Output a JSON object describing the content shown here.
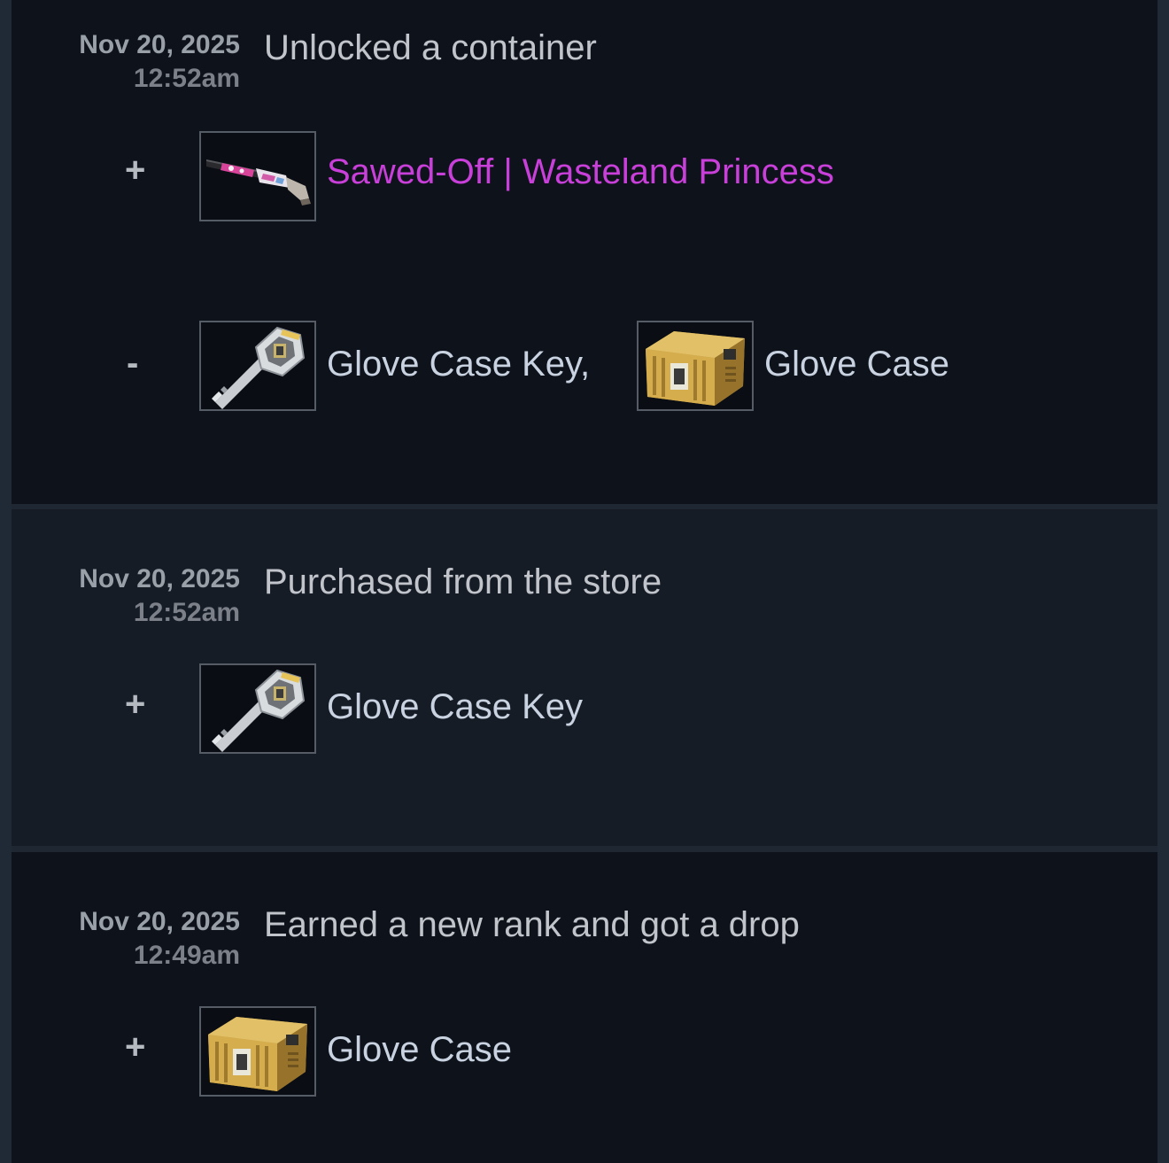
{
  "entries": [
    {
      "date": "Nov 20, 2025",
      "time": "12:52am",
      "description": "Unlocked a container",
      "gained": {
        "sign": "+",
        "items": [
          {
            "name": "Sawed-Off | Wasteland Princess",
            "icon": "sawed-off-shotgun-icon",
            "name_color": "#c93fd9"
          }
        ]
      },
      "lost": {
        "sign": "-",
        "items": [
          {
            "name": "Glove Case Key,",
            "icon": "glove-case-key-icon"
          },
          {
            "name": "Glove Case",
            "icon": "glove-case-icon"
          }
        ]
      }
    },
    {
      "date": "Nov 20, 2025",
      "time": "12:52am",
      "description": "Purchased from the store",
      "gained": {
        "sign": "+",
        "items": [
          {
            "name": "Glove Case Key",
            "icon": "glove-case-key-icon"
          }
        ]
      }
    },
    {
      "date": "Nov 20, 2025",
      "time": "12:49am",
      "description": "Earned a new rank and got a drop",
      "gained": {
        "sign": "+",
        "items": [
          {
            "name": "Glove Case",
            "icon": "glove-case-icon"
          }
        ]
      }
    }
  ],
  "colors": {
    "rare_item": "#c93fd9",
    "item_name": "#c9d2e0",
    "description": "#c1c5cb",
    "date": "#9aa0a8",
    "time": "#7b8089"
  }
}
